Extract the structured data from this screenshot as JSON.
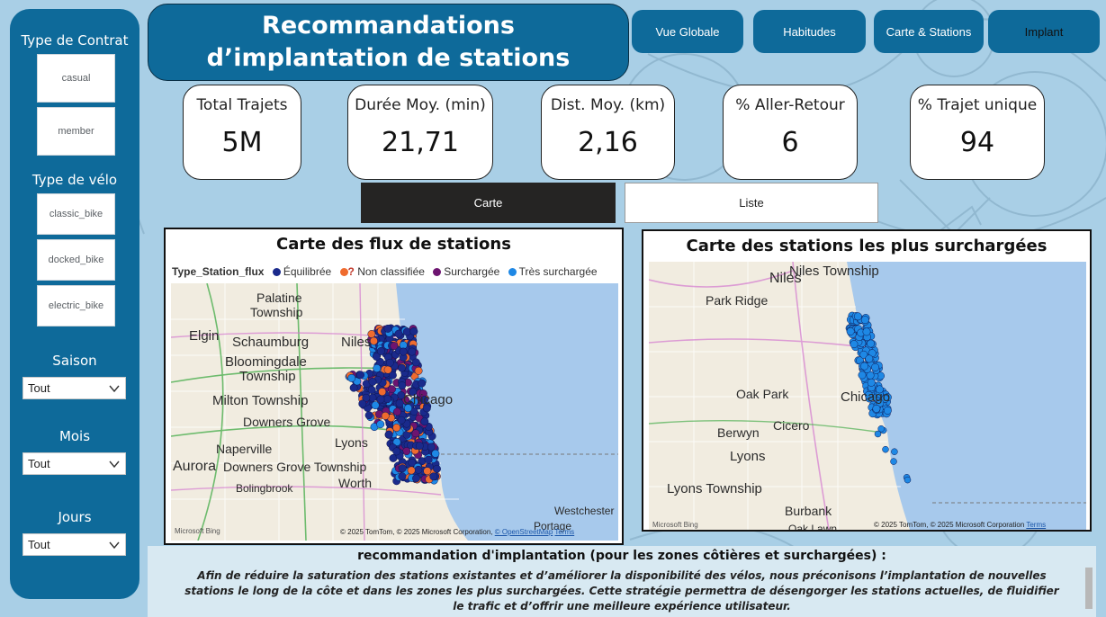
{
  "colors": {
    "primary": "#0e6a9a",
    "sidebar": "#0e6a9a",
    "toggle_active": "#252423",
    "equilibree": "#1a2a8c",
    "non_classifiee": "#ef6b2e",
    "surchargee": "#6d1470",
    "tres_surchargee": "#1e88e5"
  },
  "sidebar": {
    "contract_heading": "Type de Contrat",
    "contract_options": [
      "casual",
      "member"
    ],
    "bike_heading": "Type de vélo",
    "bike_options": [
      "classic_bike",
      "docked_bike",
      "electric_bike"
    ],
    "saison_heading": "Saison",
    "saison_value": "Tout",
    "mois_heading": "Mois",
    "mois_value": "Tout",
    "jours_heading": "Jours",
    "jours_value": "Tout"
  },
  "header": {
    "title": "Recommandations d’implantation de stations"
  },
  "nav": {
    "items": [
      "Vue Globale",
      "Habitudes",
      "Carte & Stations",
      "Implant"
    ],
    "active": "Implant"
  },
  "kpis": [
    {
      "label": "Total Trajets",
      "value": "5M"
    },
    {
      "label": "Durée Moy. (min)",
      "value": "21,71"
    },
    {
      "label": "Dist. Moy. (km)",
      "value": "2,16"
    },
    {
      "label": "% Aller-Retour",
      "value": "6"
    },
    {
      "label": "% Trajet unique",
      "value": "94"
    }
  ],
  "toggle": {
    "carte": "Carte",
    "liste": "Liste",
    "active": "Carte"
  },
  "map_flux": {
    "title": "Carte des flux de stations",
    "legend_title": "Type_Station_flux",
    "legend": [
      "Équilibrée",
      "Non classifiée",
      "Surchargée",
      "Très surchargée"
    ],
    "labels": [
      "Palatine",
      "Township",
      "Elgin",
      "Schaumburg",
      "Niles",
      "Bloomingdale",
      "Township",
      "Milton Township",
      "Downers Grove",
      "Naperville",
      "Aurora",
      "Downers Grove Township",
      "Lyons",
      "Bolingbrook",
      "Worth",
      "Westchester",
      "Portage",
      "Chicago"
    ],
    "copyright": "© 2025 TomTom, © 2025 Microsoft Corporation,",
    "osm": "© OpenStreetMap",
    "terms": "Terms",
    "bing": "Microsoft Bing"
  },
  "map_surcharge": {
    "title": "Carte des stations les plus surchargées",
    "labels": [
      "Niles",
      "Niles Township",
      "Park Ridge",
      "Oak Park",
      "Cicero",
      "Berwyn",
      "Lyons",
      "Lyons Township",
      "Burbank",
      "Oak Lawn",
      "Chicago"
    ],
    "copyright": "© 2025 TomTom, © 2025 Microsoft Corporation",
    "terms": "Terms",
    "bing": "Microsoft Bing"
  },
  "recommendation": {
    "heading": "recommandation d'implantation (pour les zones côtières et surchargées) :",
    "text": "Afin de réduire la saturation des stations existantes et d’améliorer la disponibilité des vélos, nous préconisons l’implantation de nouvelles stations le long de la côte et dans les zones les plus surchargées. Cette stratégie permettra de désengorger les stations actuelles, de fluidifier le trafic et d’offrir une meilleure expérience utilisateur."
  }
}
